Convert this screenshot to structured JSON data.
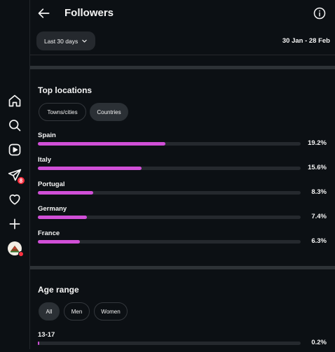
{
  "header": {
    "title": "Followers",
    "back_icon": "arrow-left-icon",
    "info_icon": "info-icon"
  },
  "period": {
    "label": "Last 30 days",
    "date_range": "30 Jan - 28 Feb"
  },
  "sidebar": {
    "items": [
      {
        "icon": "home-icon"
      },
      {
        "icon": "search-icon"
      },
      {
        "icon": "reels-icon"
      },
      {
        "icon": "direct-messages-icon",
        "badge": "8"
      },
      {
        "icon": "heart-icon"
      },
      {
        "icon": "create-icon"
      },
      {
        "icon": "profile-avatar"
      }
    ]
  },
  "top_locations": {
    "title": "Top locations",
    "tabs": [
      "Towns/cities",
      "Countries"
    ],
    "selected_tab": "Countries",
    "accent_color": "#d04fd7",
    "items": [
      {
        "name": "Spain",
        "percent": "19.2%",
        "value": 19.2
      },
      {
        "name": "Italy",
        "percent": "15.6%",
        "value": 15.6
      },
      {
        "name": "Portugal",
        "percent": "8.3%",
        "value": 8.3
      },
      {
        "name": "Germany",
        "percent": "7.4%",
        "value": 7.4
      },
      {
        "name": "France",
        "percent": "6.3%",
        "value": 6.3
      }
    ]
  },
  "age_range": {
    "title": "Age range",
    "tabs": [
      "All",
      "Men",
      "Women"
    ],
    "selected_tab": "All",
    "items": [
      {
        "name": "13-17",
        "percent": "0.2%",
        "value": 0.2
      }
    ]
  }
}
